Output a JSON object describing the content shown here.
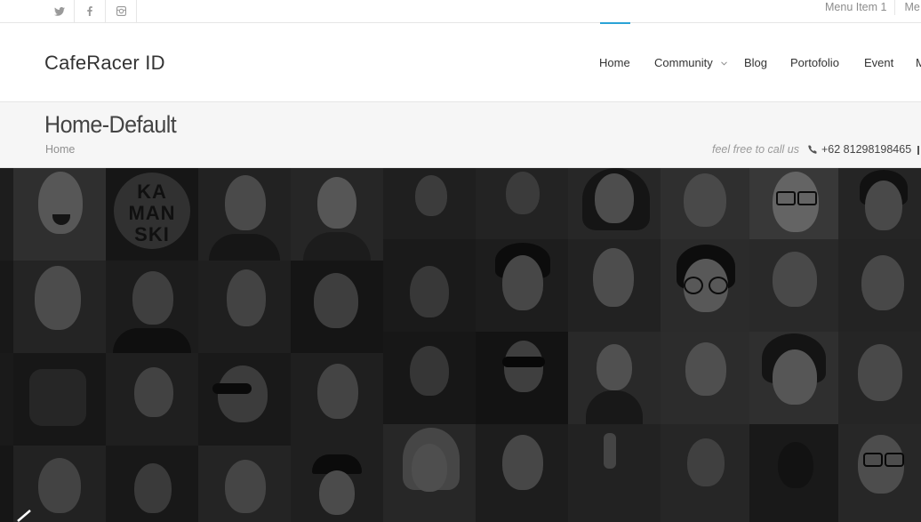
{
  "topbar": {
    "social": [
      "twitter-icon",
      "facebook-icon",
      "instagram-icon"
    ],
    "menu": [
      "Menu Item 1",
      "Me"
    ]
  },
  "header": {
    "logo": "CafeRacer ID",
    "nav": [
      {
        "label": "Home",
        "active": true
      },
      {
        "label": "Community",
        "dropdown": true
      },
      {
        "label": "Blog"
      },
      {
        "label": "Portofolio"
      },
      {
        "label": "Event"
      },
      {
        "label": "M"
      }
    ],
    "accent": "#2aa3d6"
  },
  "titlebar": {
    "title": "Home-Default",
    "breadcrumb": "Home",
    "call_text": "feel free to call us",
    "phone": "+62 81298198465"
  },
  "hero": {
    "tile_text": [
      "KA",
      "MAN",
      "SKI"
    ],
    "prev_icon": "chevron-left-icon"
  }
}
